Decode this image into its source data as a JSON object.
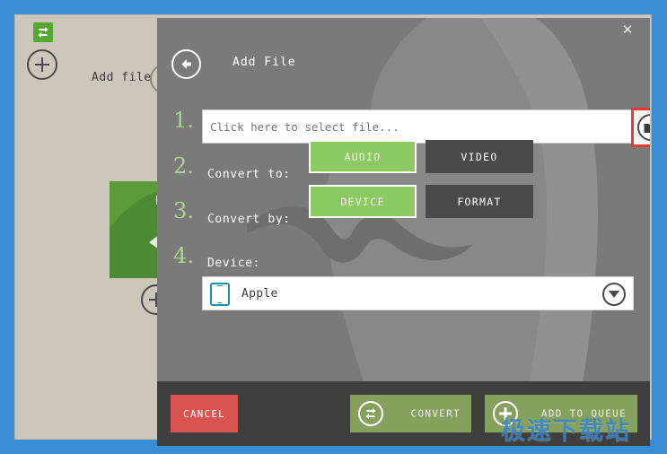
{
  "background_app": {
    "logo_icon": "convert-arrows-icon",
    "add_file_label": "Add file",
    "add_file_plus_icon": "plus-circle-icon",
    "center_plus_icon": "plus-circle-icon",
    "thumbnail_icon": "green-convert-thumbnail"
  },
  "dialog": {
    "title": "Add File",
    "back_icon": "back-arrow-icon",
    "close_icon": "close-icon",
    "steps": {
      "step1": {
        "number": "1.",
        "input_value": "",
        "input_placeholder": "Click here to select file...",
        "browse_icon": "folder-icon",
        "browse_highlight_color": "#e53935"
      },
      "step2": {
        "number": "2.",
        "label": "Convert to:",
        "options": [
          {
            "label": "AUDIO",
            "selected": true
          },
          {
            "label": "VIDEO",
            "selected": false
          }
        ]
      },
      "step3": {
        "number": "3.",
        "label": "Convert by:",
        "options": [
          {
            "label": "DEVICE",
            "selected": true
          },
          {
            "label": "FORMAT",
            "selected": false
          }
        ]
      },
      "step4": {
        "number": "4.",
        "label": "Device:",
        "selected_device": "Apple",
        "device_icon": "tablet-icon",
        "caret_icon": "chevron-down-icon"
      }
    },
    "footer": {
      "cancel_label": "CANCEL",
      "convert_label": "CONVERT",
      "convert_icon": "convert-arrows-icon",
      "queue_label": "ADD TO QUEUE",
      "queue_icon": "plus-icon"
    }
  },
  "watermark": {
    "text": "极速下载站"
  },
  "colors": {
    "accent_green": "#8dc963",
    "button_green": "#86a05e",
    "cancel_red": "#d9534f",
    "dialog_bg": "#7a7a7a",
    "footer_bg": "#3f3f3f",
    "inactive_btn": "#4a4a4a",
    "app_bg": "#cdc7bb",
    "desktop_blue": "#3a8dd2",
    "device_icon_teal": "#1f8fa6",
    "step_number_green": "#a8d98a",
    "highlight_red": "#e53935",
    "watermark_blue": "#3b84c4"
  }
}
